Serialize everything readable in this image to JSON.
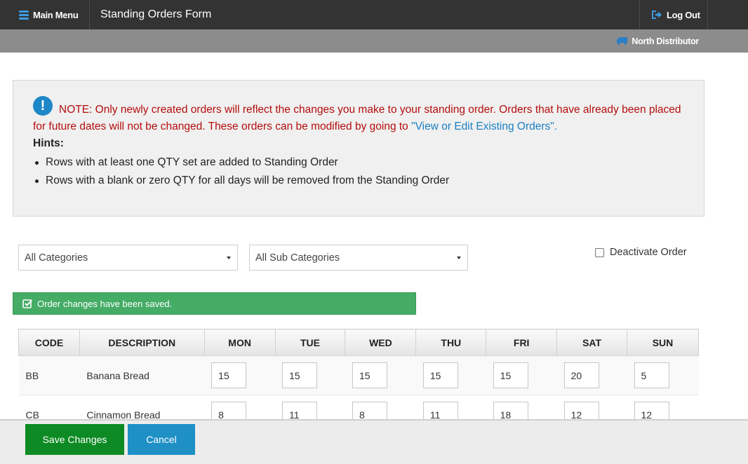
{
  "nav": {
    "menu_label": "Main Menu",
    "title": "Standing Orders Form",
    "logout_label": "Log Out",
    "distributor": "North Distributor"
  },
  "note": {
    "text_red": "NOTE: Only newly created orders will reflect the changes you make to your standing order. Orders that have already been placed for future dates will not be changed. These orders can be modified by going to",
    "link": "\"View or Edit Existing Orders\".",
    "hints_title": "Hints:",
    "hints": [
      "Rows with at least one QTY set are added to Standing Order",
      "Rows with a blank or zero QTY for all days will be removed from the Standing Order"
    ]
  },
  "filters": {
    "category": "All Categories",
    "sub_category": "All Sub Categories",
    "deactivate_label": "Deactivate Order"
  },
  "success_message": "Order changes have been saved.",
  "table": {
    "headers": [
      "CODE",
      "DESCRIPTION",
      "MON",
      "TUE",
      "WED",
      "THU",
      "FRI",
      "SAT",
      "SUN"
    ],
    "rows": [
      {
        "code": "BB",
        "description": "Banana Bread",
        "qty": [
          "15",
          "15",
          "15",
          "15",
          "15",
          "20",
          "5"
        ]
      },
      {
        "code": "CB",
        "description": "Cinnamon Bread",
        "qty": [
          "8",
          "11",
          "8",
          "11",
          "18",
          "12",
          "12"
        ]
      }
    ]
  },
  "actions": {
    "save_label": "Save Changes",
    "cancel_label": "Cancel"
  },
  "colors": {
    "topbar": "#333333",
    "subbar": "#8c8c8c",
    "note_red": "#b50d0d",
    "link_blue": "#1a7fc3",
    "success_green": "#45ac66",
    "save_green": "#0d8a23",
    "cancel_blue": "#1e90c6"
  }
}
